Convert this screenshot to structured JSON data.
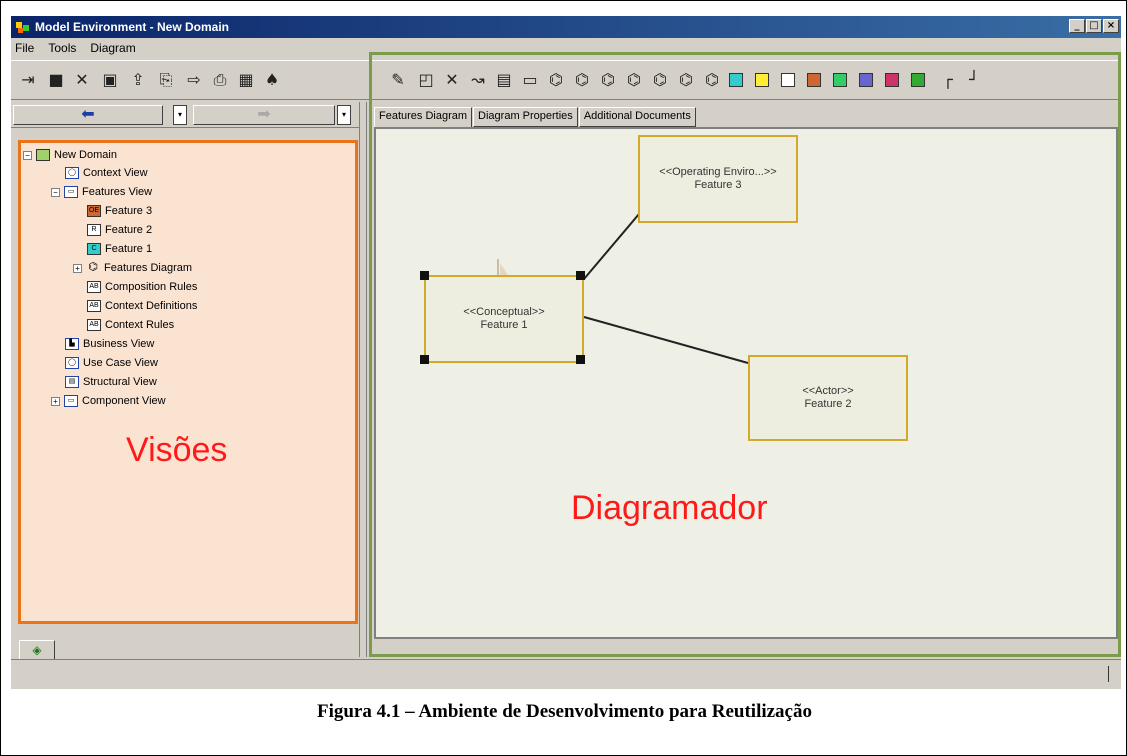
{
  "window": {
    "title": "Model Environment - New Domain",
    "controls": [
      "_",
      "□",
      "×"
    ]
  },
  "menu": [
    "File",
    "Tools",
    "Diagram"
  ],
  "toolbar_left_icons": [
    "exit-icon",
    "save-icon",
    "delete-icon",
    "image-icon",
    "export-icon",
    "import-icon",
    "print-preview-icon",
    "print-icon",
    "grid-icon",
    "find-icon"
  ],
  "toolbar_right_icons": [
    "edit-icon",
    "new-icon",
    "delete-icon",
    "link-icon",
    "document-icon",
    "folder-icon",
    "tree-icon"
  ],
  "nav": {
    "back": "⬅",
    "forward": "➡"
  },
  "tree": {
    "root": "New Domain",
    "items": [
      {
        "label": "Context View"
      },
      {
        "label": "Features View"
      },
      {
        "label": "Feature 3"
      },
      {
        "label": "Feature 2"
      },
      {
        "label": "Feature 1"
      },
      {
        "label": "Features Diagram"
      },
      {
        "label": "Composition Rules"
      },
      {
        "label": "Context Definitions"
      },
      {
        "label": "Context Rules"
      },
      {
        "label": "Business View"
      },
      {
        "label": "Use Case View"
      },
      {
        "label": "Structural View"
      },
      {
        "label": "Component View"
      }
    ]
  },
  "left_annotation": "Visões",
  "tabs": [
    "Features Diagram",
    "Diagram Properties",
    "Additional Documents"
  ],
  "diagram": {
    "nodes": [
      {
        "stereotype": "<<Operating Enviro...>>",
        "name": "Feature 3"
      },
      {
        "stereotype": "<<Conceptual>>",
        "name": "Feature 1"
      },
      {
        "stereotype": "<<Actor>>",
        "name": "Feature 2"
      }
    ]
  },
  "right_annotation": "Diagramador",
  "caption": "Figura 4.1 – Ambiente de Desenvolvimento para Reutilização",
  "colors": {
    "tree_border": "#e8731a",
    "diagram_border": "#7a9c4b",
    "annotation_text": "#ff1a1a"
  }
}
